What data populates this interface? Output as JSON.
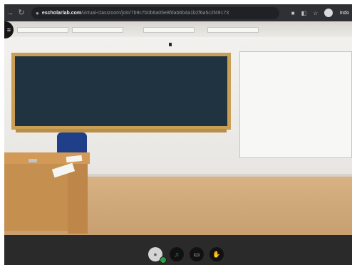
{
  "browser": {
    "back_icon": "back-arrow-icon",
    "reload_icon": "reload-icon",
    "url_domain": "escholarlab.com",
    "url_path": "/virtual-classroom/join/7b9c7b0b6a05e8fdab6b4a1b2f6a5c2f49173",
    "bookmark_icon": "bookmark-icon",
    "extensions_icon": "extensions-icon",
    "profile_label": "Indo"
  },
  "scene": {
    "menu_icon": "menu-icon",
    "description": "virtual classroom view"
  },
  "toolbar": {
    "avatar_icon": "user-avatar-icon",
    "mic_icon": "microphone-icon",
    "screen_icon": "screen-share-icon",
    "hand_icon": "raise-hand-icon"
  },
  "colors": {
    "browser_bar": "#2f3033",
    "bottom_toolbar": "#2a2a2a",
    "status_green": "#2e9b45"
  }
}
